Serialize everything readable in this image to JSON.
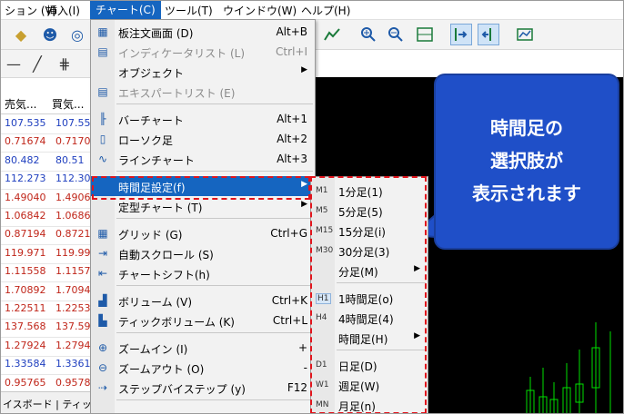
{
  "menubar": {
    "items": [
      {
        "label": "ション (V)"
      },
      {
        "label": "挿入(I)"
      },
      {
        "label": "チャート(C)"
      },
      {
        "label": "ツール(T)"
      },
      {
        "label": "ウインドウ(W)"
      },
      {
        "label": "ヘルプ(H)"
      }
    ]
  },
  "market_watch": {
    "header_sell": "売気...",
    "header_buy": "買気...",
    "rows": [
      {
        "sell": "107.535",
        "buy": "107.55",
        "color": "blue"
      },
      {
        "sell": "0.71674",
        "buy": "0.7170",
        "color": "red"
      },
      {
        "sell": "80.482",
        "buy": "80.51",
        "color": "blue"
      },
      {
        "sell": "112.273",
        "buy": "112.30",
        "color": "blue"
      },
      {
        "sell": "1.49040",
        "buy": "1.4906",
        "color": "red"
      },
      {
        "sell": "1.06842",
        "buy": "1.0686",
        "color": "red"
      },
      {
        "sell": "0.87194",
        "buy": "0.8721",
        "color": "red"
      },
      {
        "sell": "119.971",
        "buy": "119.99",
        "color": "red"
      },
      {
        "sell": "1.11558",
        "buy": "1.1157",
        "color": "red"
      },
      {
        "sell": "1.70892",
        "buy": "1.7094",
        "color": "red"
      },
      {
        "sell": "1.22511",
        "buy": "1.2253",
        "color": "red"
      },
      {
        "sell": "137.568",
        "buy": "137.59",
        "color": "red"
      },
      {
        "sell": "1.27924",
        "buy": "1.2794",
        "color": "red"
      },
      {
        "sell": "1.33584",
        "buy": "1.3361",
        "color": "blue"
      },
      {
        "sell": "0.95765",
        "buy": "0.9578",
        "color": "red"
      }
    ],
    "tabs_text": "イスボード | ティック"
  },
  "chart_menu": {
    "items": [
      {
        "icon": "board-icon",
        "label": "板注文画面 (D)",
        "shortcut": "Alt+B",
        "disabled": false,
        "arrow": false
      },
      {
        "icon": "indicator-list-icon",
        "label": "インディケータリスト (L)",
        "shortcut": "Ctrl+I",
        "disabled": true,
        "arrow": false
      },
      {
        "icon": "",
        "label": "オブジェクト",
        "shortcut": "",
        "disabled": false,
        "arrow": true
      },
      {
        "icon": "expert-list-icon",
        "label": "エキスパートリスト (E)",
        "shortcut": "",
        "disabled": true,
        "arrow": false
      },
      {
        "icon": "bar-chart-icon",
        "label": "バーチャート",
        "shortcut": "Alt+1",
        "disabled": false,
        "arrow": false
      },
      {
        "icon": "candle-icon",
        "label": "ローソク足",
        "shortcut": "Alt+2",
        "disabled": false,
        "arrow": false
      },
      {
        "icon": "line-chart-icon",
        "label": "ラインチャート",
        "shortcut": "Alt+3",
        "disabled": false,
        "arrow": false
      },
      {
        "icon": "",
        "label": "時間足設定(f)",
        "shortcut": "",
        "disabled": false,
        "arrow": true,
        "highlight": true
      },
      {
        "icon": "",
        "label": "定型チャート (T)",
        "shortcut": "",
        "disabled": false,
        "arrow": true
      },
      {
        "icon": "grid-icon",
        "label": "グリッド (G)",
        "shortcut": "Ctrl+G",
        "disabled": false,
        "arrow": false
      },
      {
        "icon": "autoscroll-icon",
        "label": "自動スクロール (S)",
        "shortcut": "",
        "disabled": false,
        "arrow": false
      },
      {
        "icon": "chart-shift-icon",
        "label": "チャートシフト(h)",
        "shortcut": "",
        "disabled": false,
        "arrow": false
      },
      {
        "icon": "volume-icon",
        "label": "ボリューム (V)",
        "shortcut": "Ctrl+K",
        "disabled": false,
        "arrow": false
      },
      {
        "icon": "tick-volume-icon",
        "label": "ティックボリューム (K)",
        "shortcut": "Ctrl+L",
        "disabled": false,
        "arrow": false
      },
      {
        "icon": "zoom-in-icon",
        "label": "ズームイン (I)",
        "shortcut": "+",
        "disabled": false,
        "arrow": false
      },
      {
        "icon": "zoom-out-icon",
        "label": "ズームアウト (O)",
        "shortcut": "-",
        "disabled": false,
        "arrow": false
      },
      {
        "icon": "step-icon",
        "label": "ステップバイステップ (y)",
        "shortcut": "F12",
        "disabled": false,
        "arrow": false
      }
    ]
  },
  "timeframe_menu": {
    "items": [
      {
        "code": "M1",
        "label": "1分足(1)",
        "arrow": false,
        "selected": false
      },
      {
        "code": "M5",
        "label": "5分足(5)",
        "arrow": false,
        "selected": false
      },
      {
        "code": "M15",
        "label": "15分足(i)",
        "arrow": false,
        "selected": false
      },
      {
        "code": "M30",
        "label": "30分足(3)",
        "arrow": false,
        "selected": false
      },
      {
        "code": "",
        "label": "分足(M)",
        "arrow": true,
        "selected": false
      },
      {
        "code": "H1",
        "label": "1時間足(o)",
        "arrow": false,
        "selected": true
      },
      {
        "code": "H4",
        "label": "4時間足(4)",
        "arrow": false,
        "selected": false
      },
      {
        "code": "",
        "label": "時間足(H)",
        "arrow": true,
        "selected": false
      },
      {
        "code": "D1",
        "label": "日足(D)",
        "arrow": false,
        "selected": false
      },
      {
        "code": "W1",
        "label": "週足(W)",
        "arrow": false,
        "selected": false
      },
      {
        "code": "MN",
        "label": "月足(n)",
        "arrow": false,
        "selected": false
      }
    ]
  },
  "callout": {
    "line1": "時間足の",
    "line2": "選択肢が",
    "line3": "表示されます"
  },
  "colors": {
    "accent": "#1565c0",
    "callout": "#1f4fc8",
    "highlight_box": "#e0141c",
    "candle_up": "#00e000"
  }
}
